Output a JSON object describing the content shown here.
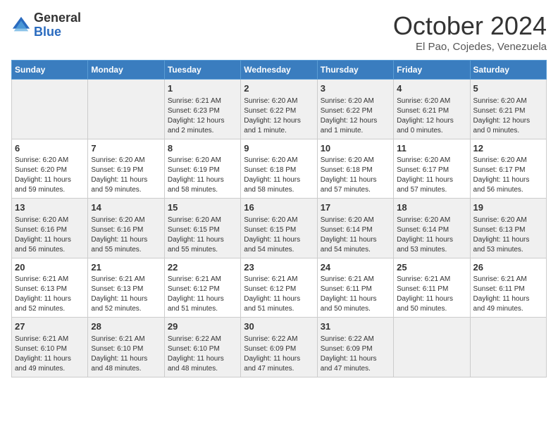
{
  "header": {
    "logo_general": "General",
    "logo_blue": "Blue",
    "month_title": "October 2024",
    "location": "El Pao, Cojedes, Venezuela"
  },
  "weekdays": [
    "Sunday",
    "Monday",
    "Tuesday",
    "Wednesday",
    "Thursday",
    "Friday",
    "Saturday"
  ],
  "weeks": [
    [
      {
        "day": "",
        "info": ""
      },
      {
        "day": "",
        "info": ""
      },
      {
        "day": "1",
        "info": "Sunrise: 6:21 AM\nSunset: 6:23 PM\nDaylight: 12 hours\nand 2 minutes."
      },
      {
        "day": "2",
        "info": "Sunrise: 6:20 AM\nSunset: 6:22 PM\nDaylight: 12 hours\nand 1 minute."
      },
      {
        "day": "3",
        "info": "Sunrise: 6:20 AM\nSunset: 6:22 PM\nDaylight: 12 hours\nand 1 minute."
      },
      {
        "day": "4",
        "info": "Sunrise: 6:20 AM\nSunset: 6:21 PM\nDaylight: 12 hours\nand 0 minutes."
      },
      {
        "day": "5",
        "info": "Sunrise: 6:20 AM\nSunset: 6:21 PM\nDaylight: 12 hours\nand 0 minutes."
      }
    ],
    [
      {
        "day": "6",
        "info": "Sunrise: 6:20 AM\nSunset: 6:20 PM\nDaylight: 11 hours\nand 59 minutes."
      },
      {
        "day": "7",
        "info": "Sunrise: 6:20 AM\nSunset: 6:19 PM\nDaylight: 11 hours\nand 59 minutes."
      },
      {
        "day": "8",
        "info": "Sunrise: 6:20 AM\nSunset: 6:19 PM\nDaylight: 11 hours\nand 58 minutes."
      },
      {
        "day": "9",
        "info": "Sunrise: 6:20 AM\nSunset: 6:18 PM\nDaylight: 11 hours\nand 58 minutes."
      },
      {
        "day": "10",
        "info": "Sunrise: 6:20 AM\nSunset: 6:18 PM\nDaylight: 11 hours\nand 57 minutes."
      },
      {
        "day": "11",
        "info": "Sunrise: 6:20 AM\nSunset: 6:17 PM\nDaylight: 11 hours\nand 57 minutes."
      },
      {
        "day": "12",
        "info": "Sunrise: 6:20 AM\nSunset: 6:17 PM\nDaylight: 11 hours\nand 56 minutes."
      }
    ],
    [
      {
        "day": "13",
        "info": "Sunrise: 6:20 AM\nSunset: 6:16 PM\nDaylight: 11 hours\nand 56 minutes."
      },
      {
        "day": "14",
        "info": "Sunrise: 6:20 AM\nSunset: 6:16 PM\nDaylight: 11 hours\nand 55 minutes."
      },
      {
        "day": "15",
        "info": "Sunrise: 6:20 AM\nSunset: 6:15 PM\nDaylight: 11 hours\nand 55 minutes."
      },
      {
        "day": "16",
        "info": "Sunrise: 6:20 AM\nSunset: 6:15 PM\nDaylight: 11 hours\nand 54 minutes."
      },
      {
        "day": "17",
        "info": "Sunrise: 6:20 AM\nSunset: 6:14 PM\nDaylight: 11 hours\nand 54 minutes."
      },
      {
        "day": "18",
        "info": "Sunrise: 6:20 AM\nSunset: 6:14 PM\nDaylight: 11 hours\nand 53 minutes."
      },
      {
        "day": "19",
        "info": "Sunrise: 6:20 AM\nSunset: 6:13 PM\nDaylight: 11 hours\nand 53 minutes."
      }
    ],
    [
      {
        "day": "20",
        "info": "Sunrise: 6:21 AM\nSunset: 6:13 PM\nDaylight: 11 hours\nand 52 minutes."
      },
      {
        "day": "21",
        "info": "Sunrise: 6:21 AM\nSunset: 6:13 PM\nDaylight: 11 hours\nand 52 minutes."
      },
      {
        "day": "22",
        "info": "Sunrise: 6:21 AM\nSunset: 6:12 PM\nDaylight: 11 hours\nand 51 minutes."
      },
      {
        "day": "23",
        "info": "Sunrise: 6:21 AM\nSunset: 6:12 PM\nDaylight: 11 hours\nand 51 minutes."
      },
      {
        "day": "24",
        "info": "Sunrise: 6:21 AM\nSunset: 6:11 PM\nDaylight: 11 hours\nand 50 minutes."
      },
      {
        "day": "25",
        "info": "Sunrise: 6:21 AM\nSunset: 6:11 PM\nDaylight: 11 hours\nand 50 minutes."
      },
      {
        "day": "26",
        "info": "Sunrise: 6:21 AM\nSunset: 6:11 PM\nDaylight: 11 hours\nand 49 minutes."
      }
    ],
    [
      {
        "day": "27",
        "info": "Sunrise: 6:21 AM\nSunset: 6:10 PM\nDaylight: 11 hours\nand 49 minutes."
      },
      {
        "day": "28",
        "info": "Sunrise: 6:21 AM\nSunset: 6:10 PM\nDaylight: 11 hours\nand 48 minutes."
      },
      {
        "day": "29",
        "info": "Sunrise: 6:22 AM\nSunset: 6:10 PM\nDaylight: 11 hours\nand 48 minutes."
      },
      {
        "day": "30",
        "info": "Sunrise: 6:22 AM\nSunset: 6:09 PM\nDaylight: 11 hours\nand 47 minutes."
      },
      {
        "day": "31",
        "info": "Sunrise: 6:22 AM\nSunset: 6:09 PM\nDaylight: 11 hours\nand 47 minutes."
      },
      {
        "day": "",
        "info": ""
      },
      {
        "day": "",
        "info": ""
      }
    ]
  ]
}
